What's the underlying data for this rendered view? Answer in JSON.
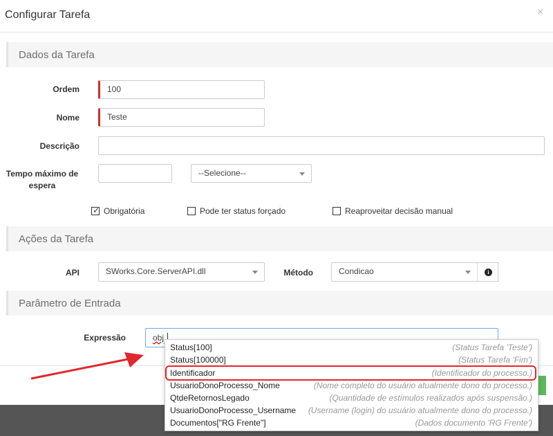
{
  "modal": {
    "title": "Configurar Tarefa",
    "close": "×"
  },
  "sections": {
    "dados": "Dados da Tarefa",
    "acoes": "Ações da Tarefa",
    "parametro": "Parâmetro de Entrada"
  },
  "form": {
    "ordem_label": "Ordem",
    "ordem_value": "100",
    "nome_label": "Nome",
    "nome_value": "Teste",
    "descricao_label": "Descrição",
    "descricao_value": "",
    "tempo_label_line1": "Tempo máximo de",
    "tempo_label_line2": "espera",
    "tempo_value": "",
    "tempo_unit": "--Selecione--"
  },
  "checkboxes": [
    {
      "label": "Obrigatória",
      "checked": true
    },
    {
      "label": "Pode ter status forçado",
      "checked": false
    },
    {
      "label": "Reaproveitar decisão manual",
      "checked": false
    }
  ],
  "acoes": {
    "api_label": "API",
    "api_value": "SWorks.Core.ServerAPI.dll",
    "metodo_label": "Método",
    "metodo_value": "Condicao",
    "info_icon": "info-icon"
  },
  "parametro": {
    "expressao_label": "Expressão",
    "expressao_value": "obj."
  },
  "autocomplete": [
    {
      "name": "Status[100]",
      "desc": "(Status Tarefa 'Teste')"
    },
    {
      "name": "Status[100000]",
      "desc": "(Status Tarefa 'Fim')"
    },
    {
      "name": "Identificador",
      "desc": "(Identificador do processo.)",
      "highlighted": true
    },
    {
      "name": "UsuarioDonoProcesso_Nome",
      "desc": "(Nome completo do usuário atualmente dono do processo.)"
    },
    {
      "name": "QtdeRetornosLegado",
      "desc": "(Quantidade de estímulos realizados após suspensão.)"
    },
    {
      "name": "UsuarioDonoProcesso_Username",
      "desc": "(Username (login) do usuário atualmente dono do processo.)"
    },
    {
      "name": "Documentos[\"RG Frente\"]",
      "desc": "(Dados documento 'RG Frente')"
    }
  ],
  "colors": {
    "required_marker": "#c9302c",
    "highlight_outline": "#e0282e",
    "arrow": "#e0282e",
    "focus_border": "#66afe9",
    "confirm_button": "#5cb85c"
  }
}
